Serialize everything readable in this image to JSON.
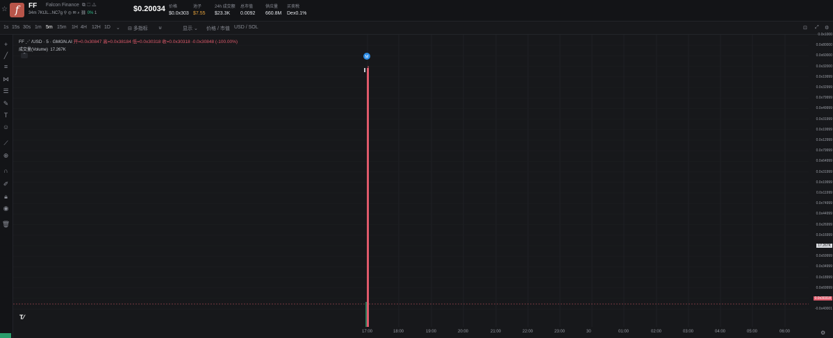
{
  "token": {
    "symbol": "FF",
    "name": "Falcon Finance",
    "age": "34m",
    "address": "7KtJL...NC7g",
    "change_pct": "0%",
    "holders_small": "1",
    "price": "$0.20034"
  },
  "stats": [
    {
      "label": "价格",
      "value": "$0.0x303"
    },
    {
      "label": "池子",
      "value": "$7.55"
    },
    {
      "label": "24h 成交额",
      "value": "$23.3K"
    },
    {
      "label": "总市值",
      "value": "0.0092"
    },
    {
      "label": "供应量",
      "value": "660.8M"
    },
    {
      "label": "买卖税",
      "value": "Dex0.1%"
    }
  ],
  "timeframes": [
    "1s",
    "15s",
    "30s",
    "1m",
    "5m",
    "15m",
    "1H",
    "4H",
    "12H",
    "1D"
  ],
  "active_timeframe": "5m",
  "toolbar": {
    "indicators": "多指标",
    "display": "显示",
    "price_mcap": "价格 / 市值",
    "currency": "USD / SOL"
  },
  "legend": {
    "title": "FF ⋰ /USD · 5 · GMGN.AI",
    "ohlc": "开=0.0x30847 高=0.0x38184 低=0.0x30318 收=0.0x30318 -0.0x30848 (-100.00%)",
    "volume_label": "成交量(Volume)",
    "volume_value": "17.267K"
  },
  "colors": {
    "up": "#2a7a5b",
    "down": "#e05a6b",
    "marker": "#2d8ce6"
  },
  "marker_label": "M",
  "chart_data": {
    "type": "candlestick",
    "x_ticks": [
      "17:00",
      "18:00",
      "19:00",
      "20:00",
      "21:00",
      "22:00",
      "23:00",
      "30",
      "01:00",
      "02:00",
      "03:00",
      "04:00",
      "05:00",
      "06:00"
    ],
    "y_ticks": [
      "0.0x1000",
      "0.0x80000",
      "0.0x60000",
      "0.0x32000",
      "0.0x19999",
      "0.0x32999",
      "0.0x79999",
      "0.0x49999",
      "0.0x31999",
      "0.0x19999",
      "0.0x12999",
      "0.0x79999",
      "0.0x64999",
      "0.0x31999",
      "0.0x19999",
      "0.0x11999",
      "0.0x74999",
      "0.0x44999",
      "0.0x26999",
      "0.0x16999",
      "17.267K",
      "0.0x59999",
      "0.0x34999",
      "0.0x18999",
      "0.0x69999",
      "0.0x30318",
      "-0.0x40001"
    ],
    "price_label": "0.0x30318",
    "volume_axis_label": "17.267K",
    "candle": {
      "time": "17:00",
      "high": 1.0,
      "low": 0.0
    }
  }
}
